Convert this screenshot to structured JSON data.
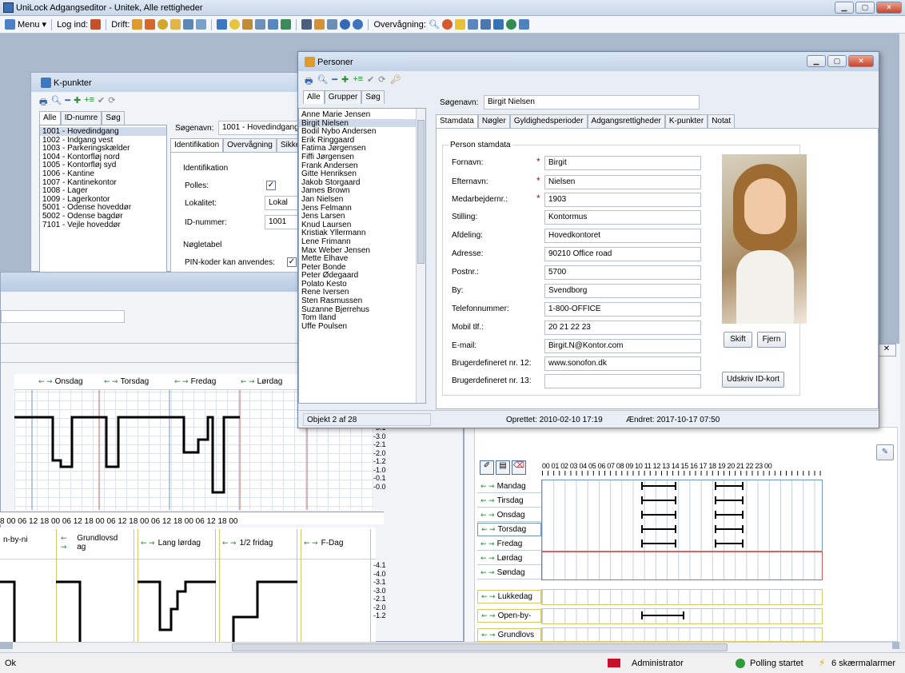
{
  "app": {
    "title": "UniLock Adgangseditor - Unitek, Alle rettigheder"
  },
  "toolbar": {
    "menu": "Menu",
    "login": "Log ind:",
    "drift": "Drift:",
    "overvaagning": "Overvågning:"
  },
  "kpunkter": {
    "title": "K-punkter",
    "tabs": [
      "Alle",
      "ID-numre",
      "Søg"
    ],
    "items": [
      "1001 - Hovedindgang",
      "1002 - Indgang vest",
      "1003 - Parkeringskælder",
      "1004 - Kontorfløj nord",
      "1005 - Kontorfløj syd",
      "1006 - Kantine",
      "1007 - Kantinekontor",
      "1008 - Lager",
      "1009 - Lagerkontor",
      "5001 - Odense hoveddør",
      "5002 - Odense bagdør",
      "7101 - Vejle hoveddør"
    ],
    "search_label": "Søgenavn:",
    "search_value": "1001 - Hovedindgang",
    "detail_tabs": [
      "Identifikation",
      "Overvågning",
      "Sikke"
    ],
    "ident_group": "Identifikation",
    "polles": "Polles:",
    "lokalitet": "Lokalitet:",
    "lokalitet_value": "Lokal",
    "idnr": "ID-nummer:",
    "idnr_value": "1001",
    "noegle_group": "Nøgletabel",
    "pin": "PIN-koder kan anvendes:"
  },
  "bgchart": {
    "days": [
      "Onsdag",
      "Torsdag",
      "Fredag",
      "Lørdag"
    ],
    "axis": "8  00  06  12  18  00  06  12  18  00  06  12  18  00  06  12  18  00  06  12  18  00",
    "row2": [
      "n-by-ni",
      "Grundlovsd ag",
      "Lang lørdag",
      "1/2 fridag",
      "F-Dag"
    ],
    "scale1": [
      "-3.1",
      "-3.0",
      "-2.1",
      "-2.0",
      "-1.2",
      "-1.0",
      "-0.1",
      "-0.0"
    ],
    "scale2": [
      "-4.1",
      "-4.0",
      "-3.1",
      "-3.0",
      "-2.1",
      "-2.0",
      "-1.2"
    ]
  },
  "personer": {
    "title": "Personer",
    "list_tabs": [
      "Alle",
      "Grupper",
      "Søg"
    ],
    "names": [
      "Anne Marie Jensen",
      "Birgit Nielsen",
      "Bodil Nybo Andersen",
      "Erik Ringgaard",
      "Fatima Jørgensen",
      "Fiffi Jørgensen",
      "Frank Andersen",
      "Gitte Henriksen",
      "Jakob Storgaard",
      "James Brown",
      "Jan Nielsen",
      "Jens Felmann",
      "Jens Larsen",
      "Knud Laursen",
      "Kristiak Yllermann",
      "Lene Frimann",
      "Max Weber Jensen",
      "Mette Elhave",
      "Peter Bonde",
      "Peter Ødegaard",
      "Polato Kesto",
      "Rene Iversen",
      "Sten Rasmussen",
      "Suzanne Bjerrehus",
      "Tom Iland",
      "Uffe Poulsen"
    ],
    "search_label": "Søgenavn:",
    "search_value": "Birgit Nielsen",
    "tabs": [
      "Stamdata",
      "Nøgler",
      "Gyldighedsperioder",
      "Adgangsrettigheder",
      "K-punkter",
      "Notat"
    ],
    "group": "Person stamdata",
    "fields": [
      {
        "label": "Fornavn:",
        "value": "Birgit",
        "req": "*"
      },
      {
        "label": "Efternavn:",
        "value": "Nielsen",
        "req": "*"
      },
      {
        "label": "Medarbejdernr.:",
        "value": "1903",
        "req": "*"
      },
      {
        "label": "Stilling:",
        "value": "Kontormus",
        "req": ""
      },
      {
        "label": "Afdeling:",
        "value": "Hovedkontoret",
        "req": ""
      },
      {
        "label": "Adresse:",
        "value": "90210 Office road",
        "req": ""
      },
      {
        "label": "Postnr.:",
        "value": "5700",
        "req": ""
      },
      {
        "label": "By:",
        "value": "Svendborg",
        "req": ""
      },
      {
        "label": "Telefonnummer:",
        "value": "1-800-OFFICE",
        "req": ""
      },
      {
        "label": "Mobil tlf.:",
        "value": "20 21 22 23",
        "req": ""
      },
      {
        "label": "E-mail:",
        "value": "Birgit.N@Kontor.com",
        "req": ""
      },
      {
        "label": "Brugerdefineret nr. 12:",
        "value": "www.sonofon.dk",
        "req": ""
      },
      {
        "label": "Brugerdefineret nr. 13:",
        "value": "",
        "req": ""
      }
    ],
    "btn_skift": "Skift",
    "btn_fjern": "Fjern",
    "btn_udskriv": "Udskriv ID-kort",
    "status_obj": "Objekt 2 af 28",
    "status_oprettet": "Oprettet: 2010-02-10  17:19",
    "status_aendret": "Ændret: 2017-10-17  07:50"
  },
  "week": {
    "hours": "00 01 02 03 04 05 06 07 08 09 10 11 12 13 14 15 16 17 18 19 20 21 22 23 00",
    "days": [
      "Mandag",
      "Tirsdag",
      "Onsdag",
      "Torsdag",
      "Fredag",
      "Lørdag",
      "Søndag"
    ],
    "special": [
      "Lukkedag",
      "Open-by-",
      "Grundlovs"
    ]
  },
  "statusbar": {
    "ok": "Ok",
    "user": "Administrator",
    "polling": "Polling startet",
    "alarms": "6 skærmalarmer"
  },
  "colors": {
    "accent": "#3b6fb6",
    "req": "#cc0000",
    "weekend": "#d63a3a"
  }
}
